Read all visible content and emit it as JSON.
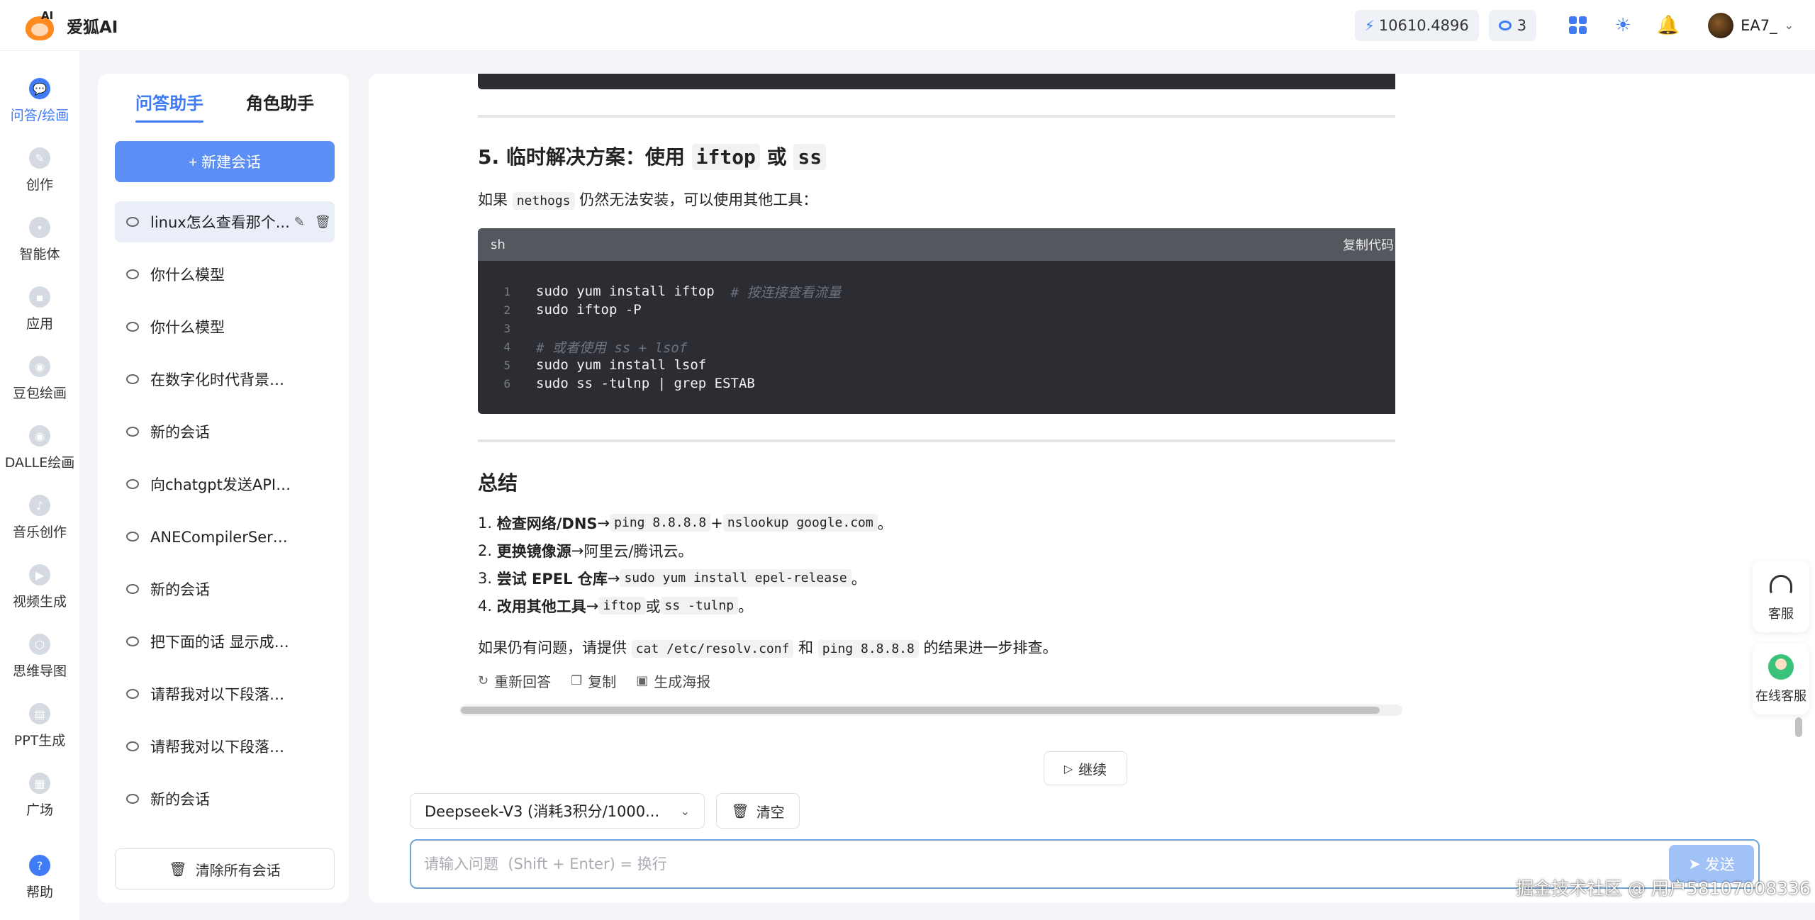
{
  "app": {
    "ai_mark": "AI",
    "name": "爱狐AI"
  },
  "header": {
    "points": "10610.4896",
    "points_icon": "bolt-icon",
    "messages_count": "3",
    "icons": [
      "apps-grid-icon",
      "sun-icon",
      "bell-icon"
    ],
    "user_name": "EA7_",
    "accent_color": "#3f7bf5"
  },
  "leftnav": {
    "items": [
      {
        "label": "问答/绘画",
        "icon": "chat-icon",
        "active": true
      },
      {
        "label": "创作",
        "icon": "pen-icon"
      },
      {
        "label": "智能体",
        "icon": "robot-icon"
      },
      {
        "label": "应用",
        "icon": "app-icon"
      },
      {
        "label": "豆包绘画",
        "icon": "palette-icon"
      },
      {
        "label": "DALLE绘画",
        "icon": "palette-icon"
      },
      {
        "label": "音乐创作",
        "icon": "music-icon"
      },
      {
        "label": "视频生成",
        "icon": "video-icon"
      },
      {
        "label": "思维导图",
        "icon": "mindmap-icon"
      },
      {
        "label": "PPT生成",
        "icon": "ppt-icon"
      },
      {
        "label": "广场",
        "icon": "square-icon"
      },
      {
        "label": "帮助",
        "icon": "help-icon"
      }
    ]
  },
  "conversations": {
    "tabs": [
      "问答助手",
      "角色助手"
    ],
    "new_chat_label": "+ 新建会话",
    "items": [
      "linux怎么查看那个...",
      "你什么模型",
      "你什么模型",
      "在数字化时代背景下，...",
      "新的会话",
      "向chatgpt发送API请求...",
      "ANECompilerService是什",
      "新的会话",
      "把下面的话 显示成人类...",
      "请帮我对以下段落进行...",
      "请帮我对以下段落进行...",
      "新的会话"
    ],
    "clear_all_label": "清除所有会话"
  },
  "message": {
    "section5_title_prefix": "5. 临时解决方案：使用 ",
    "section5_code1": "iftop",
    "section5_mid": " 或 ",
    "section5_code2": "ss",
    "section5_para_prefix": "如果 ",
    "section5_para_code": "nethogs",
    "section5_para_suffix": " 仍然无法安装，可以使用其他工具：",
    "code_lang": "sh",
    "copy_code_label": "复制代码",
    "code_lines": [
      {
        "n": "1",
        "code": "sudo yum install iftop  ",
        "comment": "# 按连接查看流量"
      },
      {
        "n": "2",
        "code": "sudo iftop -P",
        "comment": ""
      },
      {
        "n": "3",
        "code": "",
        "comment": ""
      },
      {
        "n": "4",
        "code": "",
        "comment": "# 或者使用 ss + lsof"
      },
      {
        "n": "5",
        "code": "sudo yum install lsof",
        "comment": ""
      },
      {
        "n": "6",
        "code": "sudo ss -tulnp | grep ESTAB",
        "comment": ""
      }
    ],
    "summary_title": "总结",
    "summary": [
      {
        "num": "1.",
        "bold": "检查网络/DNS",
        "arrow": " → ",
        "c1": "ping 8.8.8.8",
        "mid": " + ",
        "c2": "nslookup google.com",
        "end": "。"
      },
      {
        "num": "2.",
        "bold": "更换镜像源",
        "arrow": " → ",
        "text": "阿里云/腾讯云。"
      },
      {
        "num": "3.",
        "bold": "尝试 EPEL 仓库",
        "arrow": " → ",
        "c1": "sudo yum install epel-release",
        "end": "。"
      },
      {
        "num": "4.",
        "bold": "改用其他工具",
        "arrow": " → ",
        "c1": "iftop",
        "mid": " 或 ",
        "c2": "ss -tulnp",
        "end": "。"
      }
    ],
    "final_prefix": "如果仍有问题，请提供 ",
    "final_code1": "cat /etc/resolv.conf",
    "final_mid": " 和 ",
    "final_code2": "ping 8.8.8.8",
    "final_suffix": " 的结果进一步排查。",
    "actions": [
      "重新回答",
      "复制",
      "生成海报"
    ]
  },
  "composer": {
    "continue_label": "继续",
    "model_label": "Deepseek-V3 (消耗3积分/1000...",
    "clear_label": "清空",
    "input_placeholder": "请输入问题  (Shift + Enter) = 换行",
    "send_label": "发送"
  },
  "floating": {
    "support_label": "客服",
    "online_support_label": "在线客服"
  },
  "footer_watermark": "掘金技术社区 @ 用户58107008336"
}
